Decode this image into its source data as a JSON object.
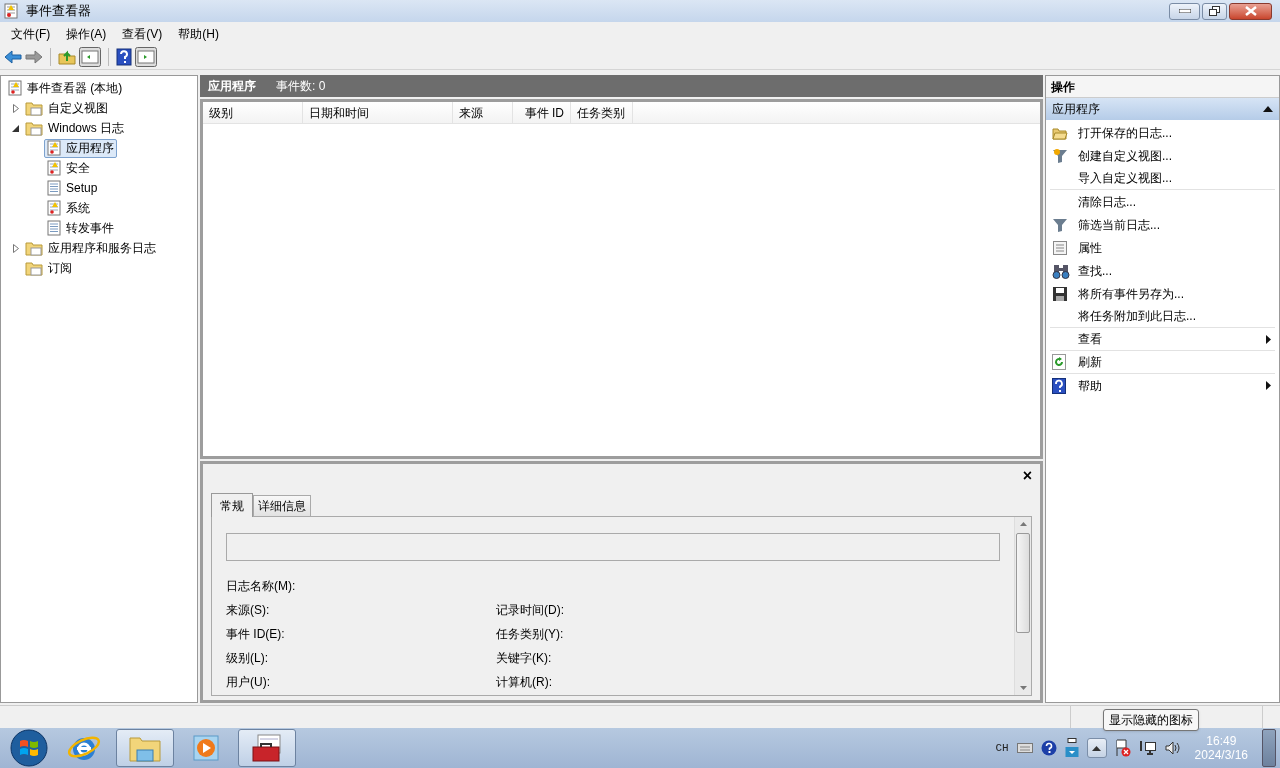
{
  "window": {
    "title": "事件查看器"
  },
  "menu": [
    {
      "label": "文件(F)"
    },
    {
      "label": "操作(A)"
    },
    {
      "label": "查看(V)"
    },
    {
      "label": "帮助(H)"
    }
  ],
  "tree": [
    {
      "label": "事件查看器 (本地)",
      "kind": "log",
      "selected": false,
      "children": [
        {
          "label": "自定义视图",
          "kind": "folder",
          "expanded": false,
          "selected": false
        },
        {
          "label": "Windows 日志",
          "kind": "folder",
          "expanded": true,
          "selected": false,
          "children": [
            {
              "label": "应用程序",
              "kind": "log",
              "selected": true
            },
            {
              "label": "安全",
              "kind": "log",
              "selected": false
            },
            {
              "label": "Setup",
              "kind": "plain",
              "selected": false
            },
            {
              "label": "系统",
              "kind": "log",
              "selected": false
            },
            {
              "label": "转发事件",
              "kind": "plain",
              "selected": false
            }
          ]
        },
        {
          "label": "应用程序和服务日志",
          "kind": "folder",
          "expanded": false,
          "selected": false
        },
        {
          "label": "订阅",
          "kind": "folder",
          "selected": false
        }
      ]
    }
  ],
  "center": {
    "title": "应用程序",
    "count": "事件数: 0",
    "columns": [
      "级别",
      "日期和时间",
      "来源",
      "事件 ID",
      "任务类别"
    ],
    "detail": {
      "close": "×",
      "tabs": [
        {
          "label": "常规",
          "selected": true
        },
        {
          "label": "详细信息",
          "selected": false
        }
      ],
      "fields": [
        {
          "left": "日志名称(M):"
        },
        {
          "left": "来源(S):",
          "right": "记录时间(D):"
        },
        {
          "left": "事件 ID(E):",
          "right": "任务类别(Y):"
        },
        {
          "left": "级别(L):",
          "right": "关键字(K):"
        },
        {
          "left": "用户(U):",
          "right": "计算机(R):"
        }
      ]
    }
  },
  "actions": {
    "title": "操作",
    "section": "应用程序",
    "items": [
      {
        "label": "打开保存的日志...",
        "submenu": false,
        "separator_after": false
      },
      {
        "label": "创建自定义视图...",
        "submenu": false,
        "separator_after": false
      },
      {
        "label": "导入自定义视图...",
        "submenu": false,
        "separator_after": true
      },
      {
        "label": "清除日志...",
        "submenu": false,
        "separator_after": false
      },
      {
        "label": "筛选当前日志...",
        "submenu": false,
        "separator_after": false
      },
      {
        "label": "属性",
        "submenu": false,
        "separator_after": false
      },
      {
        "label": "查找...",
        "submenu": false,
        "separator_after": false
      },
      {
        "label": "将所有事件另存为...",
        "submenu": false,
        "separator_after": false
      },
      {
        "label": "将任务附加到此日志...",
        "submenu": false,
        "separator_after": true
      },
      {
        "label": "查看",
        "submenu": true,
        "separator_after": true
      },
      {
        "label": "刷新",
        "submenu": false,
        "separator_after": true
      },
      {
        "label": "帮助",
        "submenu": true,
        "separator_after": false
      }
    ]
  },
  "taskbar": {
    "apps": [
      {
        "selected": false
      },
      {
        "selected": true
      },
      {
        "selected": false
      },
      {
        "selected": true
      }
    ],
    "language": "CH",
    "time": "16:49",
    "date": "2024/3/16",
    "tooltip": "显示隐藏的图标"
  }
}
